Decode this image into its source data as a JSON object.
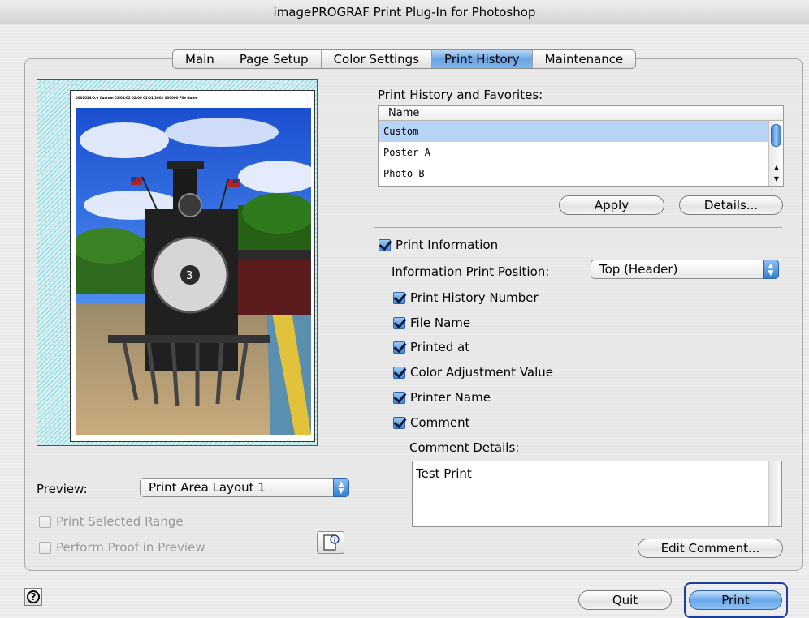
{
  "window": {
    "title": "imagePROGRAF Print Plug-In for Photoshop"
  },
  "tabs": [
    {
      "label": "Main"
    },
    {
      "label": "Page Setup"
    },
    {
      "label": "Color Settings"
    },
    {
      "label": "Print History",
      "active": true
    },
    {
      "label": "Maintenance"
    }
  ],
  "preview_panel": {
    "page_header_text": "0001024-0.0 Custom 01/01/02 02:00 01/01/2002 000000 File Name",
    "preview_label": "Preview:",
    "preview_select_value": "Print Area Layout 1",
    "print_selected_range_label": "Print Selected Range",
    "print_selected_range_checked": false,
    "perform_proof_label": "Perform Proof in Preview",
    "perform_proof_checked": false,
    "proof_icon": "page-info-icon"
  },
  "history": {
    "section_label": "Print History and Favorites:",
    "column_name": "Name",
    "items": [
      {
        "name": "Custom",
        "selected": true
      },
      {
        "name": "Poster A",
        "selected": false
      },
      {
        "name": "Photo B",
        "selected": false
      }
    ],
    "apply_label": "Apply",
    "details_label": "Details..."
  },
  "print_info": {
    "label": "Print Information",
    "checked": true,
    "position_label": "Information Print Position:",
    "position_value": "Top (Header)",
    "options": [
      {
        "label": "Print History Number",
        "checked": true
      },
      {
        "label": "File Name",
        "checked": true
      },
      {
        "label": "Printed at",
        "checked": true
      },
      {
        "label": "Color Adjustment Value",
        "checked": true
      },
      {
        "label": "Printer Name",
        "checked": true
      },
      {
        "label": "Comment",
        "checked": true
      }
    ],
    "comment_details_label": "Comment Details:",
    "comment_text": "Test Print",
    "edit_comment_label": "Edit Comment..."
  },
  "footer": {
    "help_icon": "question-mark-icon",
    "help_glyph": "?",
    "quit_label": "Quit",
    "print_label": "Print"
  },
  "colors": {
    "accent": "#6aa8ea",
    "selection": "#b7d3f5",
    "focus_ring": "#1e3f97",
    "hatch": "#8fd4dc"
  }
}
